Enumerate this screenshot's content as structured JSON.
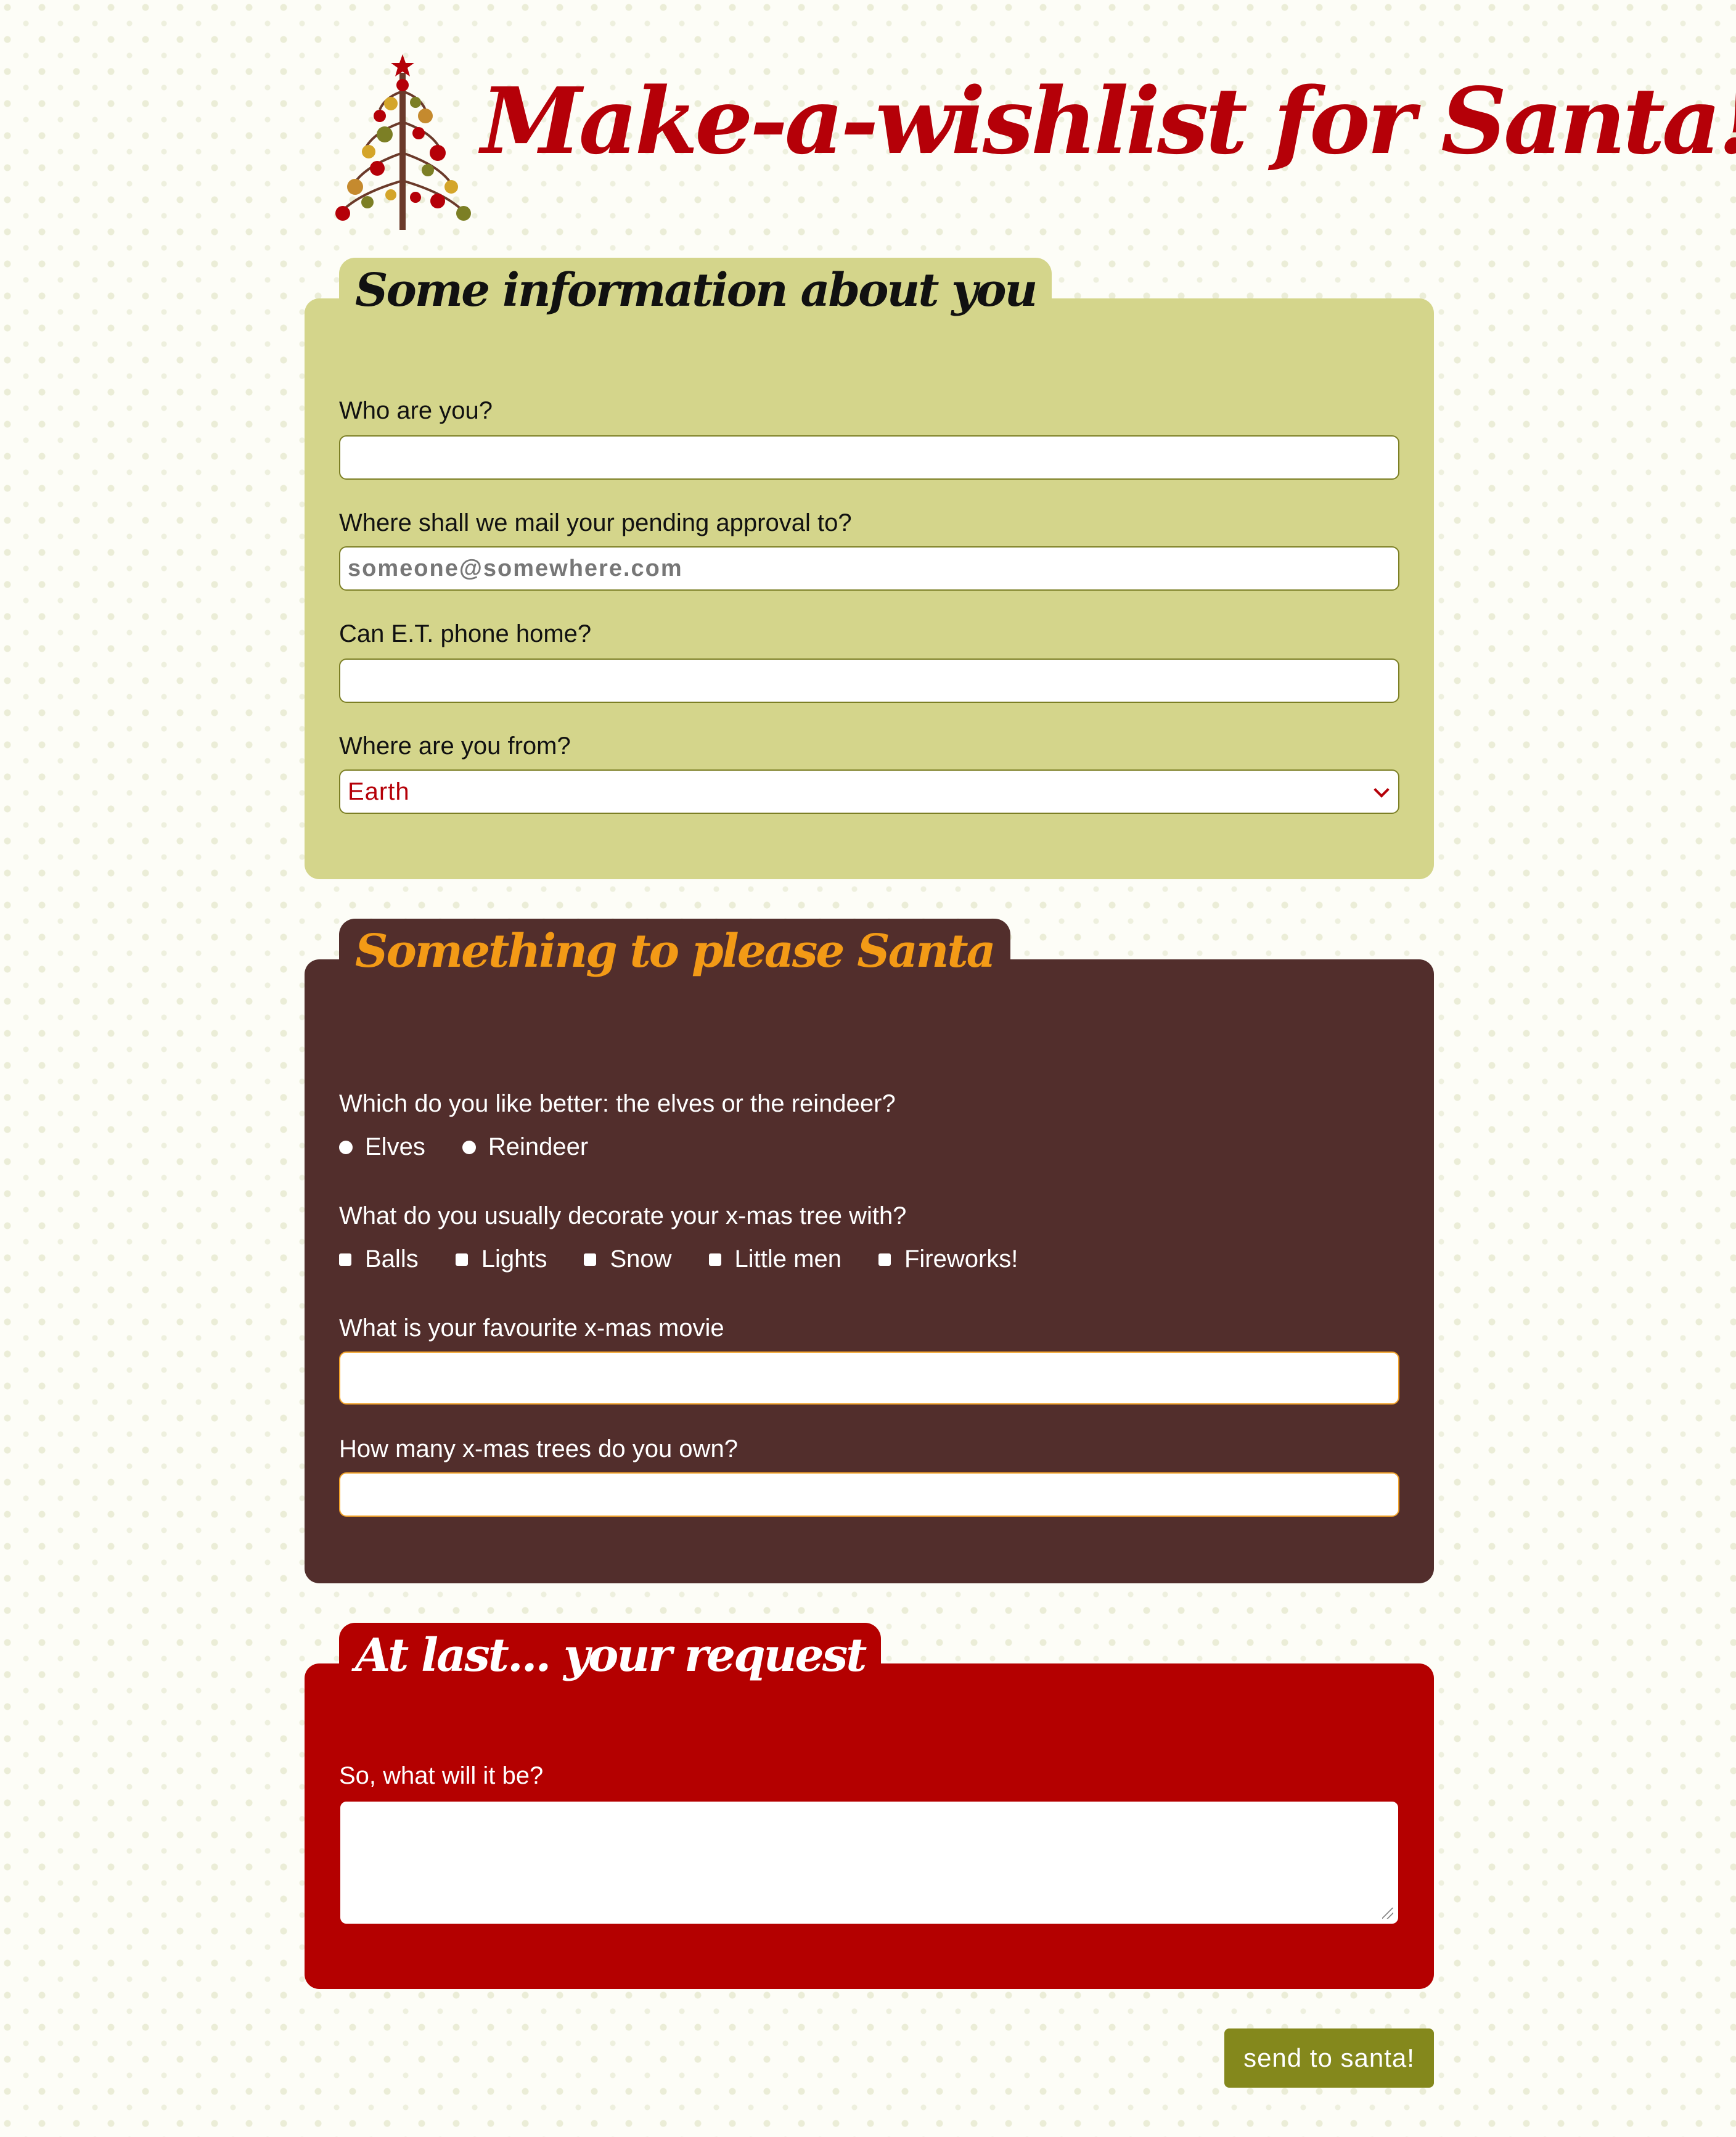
{
  "header": {
    "title": "Make-a-wishlist for Santa!",
    "logo_icon": "christmas-tree-icon"
  },
  "section_about": {
    "legend": "Some information about you",
    "fields": {
      "name": {
        "label": "Who are you?",
        "value": ""
      },
      "email": {
        "label": "Where shall we mail your pending approval to?",
        "placeholder": "someone@somewhere.com",
        "value": ""
      },
      "phone": {
        "label": "Can E.T. phone home?",
        "value": ""
      },
      "origin": {
        "label": "Where are you from?",
        "selected": "Earth"
      }
    }
  },
  "section_santa": {
    "legend": "Something to please Santa",
    "preference": {
      "label": "Which do you like better: the elves or the reindeer?",
      "options": [
        "Elves",
        "Reindeer"
      ]
    },
    "decorations": {
      "label": "What do you usually decorate your x-mas tree with?",
      "options": [
        "Balls",
        "Lights",
        "Snow",
        "Little men",
        "Fireworks!"
      ]
    },
    "movie": {
      "label": "What is your favourite x-mas movie",
      "value": ""
    },
    "trees": {
      "label": "How many x-mas trees do you own?",
      "value": ""
    }
  },
  "section_request": {
    "legend": "At last... your request",
    "request": {
      "label": "So, what will it be?",
      "value": ""
    }
  },
  "submit_label": "send to santa!",
  "colors": {
    "brand_red": "#b50008",
    "box_green": "#d4d58b",
    "box_brown": "#522e2c",
    "box_red": "#b40000",
    "accent_orange": "#f39a16",
    "button_olive": "#84881c"
  }
}
